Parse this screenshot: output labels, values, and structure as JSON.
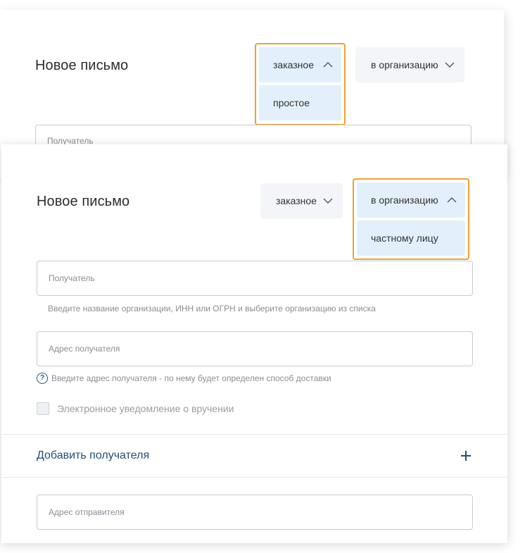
{
  "back_card": {
    "title": "Новое письмо",
    "type_select": {
      "selected": "заказное",
      "option": "простое"
    },
    "recipient_type_select": {
      "selected": "в организацию"
    },
    "recipient_field": {
      "placeholder": "Получатель"
    }
  },
  "front_card": {
    "title": "Новое письмо",
    "type_select": {
      "selected": "заказное"
    },
    "recipient_type_select": {
      "selected": "в организацию",
      "option": "частному лицу"
    },
    "recipient_field": {
      "placeholder": "Получатель",
      "hint": "Введите название организации, ИНН или ОГРН и выберите организацию из списка"
    },
    "address_field": {
      "placeholder": "Адрес получателя",
      "hint": "Введите адрес получателя - по нему будет определен способ доставки"
    },
    "notification_checkbox": {
      "label": "Электронное уведомление о вручении",
      "checked": false
    },
    "add_recipient": {
      "label": "Добавить получателя"
    },
    "sender_address_field": {
      "placeholder": "Адрес отправителя"
    }
  },
  "colors": {
    "accent_outline": "#f0a030",
    "option_bg": "#e3f0fb",
    "select_bg": "#f3f5f8",
    "link": "#1f4f7c"
  },
  "icons": [
    "chevron-up-icon",
    "chevron-down-icon",
    "help-icon",
    "plus-icon"
  ]
}
